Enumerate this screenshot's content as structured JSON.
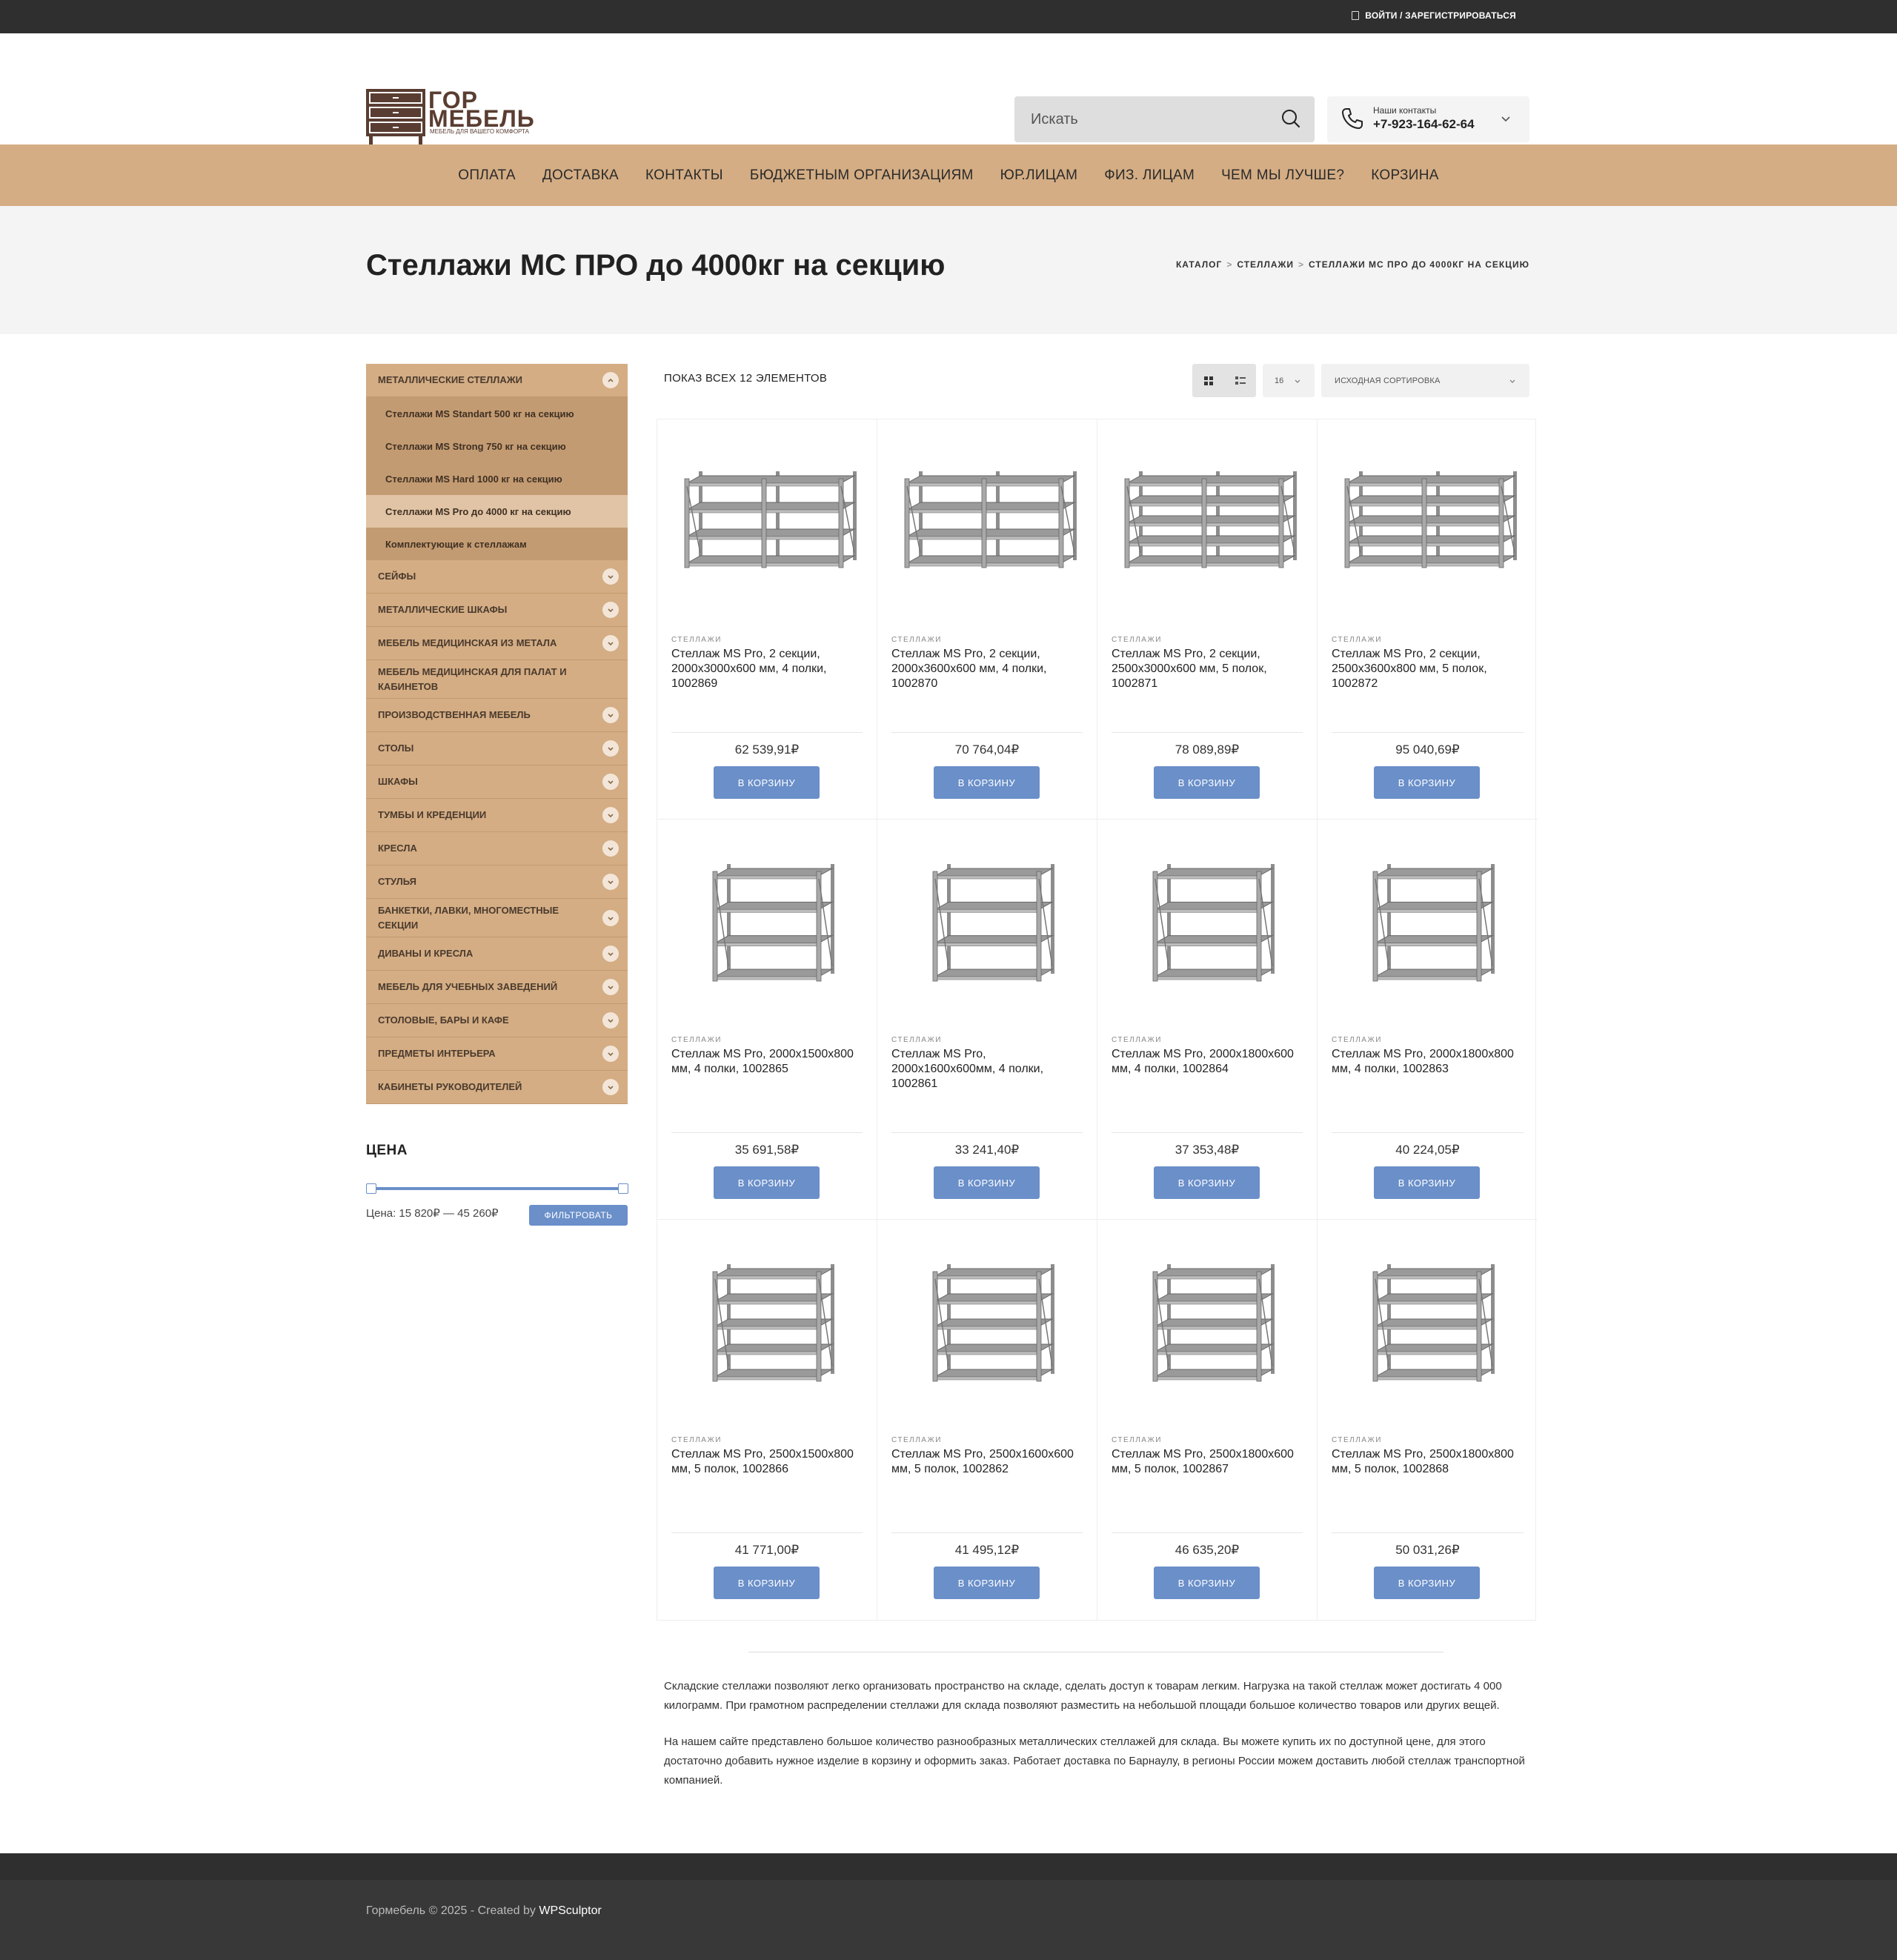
{
  "topbar": {
    "login_label": "ВОЙТИ / ЗАРЕГИСТРИРОВАТЬСЯ"
  },
  "logo": {
    "line1": "ГОР",
    "line2": "МЕБЕЛЬ",
    "tagline": "МЕБЕЛЬ ДЛЯ ВАШЕГО КОМФОРТА"
  },
  "search": {
    "placeholder": "Искать"
  },
  "contacts": {
    "label": "Наши контакты",
    "phone": "+7-923-164-62-64"
  },
  "nav": [
    "ОПЛАТА",
    "ДОСТАВКА",
    "КОНТАКТЫ",
    "БЮДЖЕТНЫМ ОРГАНИЗАЦИЯМ",
    "ЮР.ЛИЦАМ",
    "ФИЗ. ЛИЦАМ",
    "ЧЕМ МЫ ЛУЧШЕ?",
    "КОРЗИНА"
  ],
  "page": {
    "title": "Стеллажи МС ПРО до 4000кг на секцию",
    "breadcrumbs": [
      "КАТАЛОГ",
      "СТЕЛЛАЖИ",
      "СТЕЛЛАЖИ МС ПРО ДО 4000КГ НА СЕКЦИЮ"
    ]
  },
  "sidebar": {
    "open_category": "МЕТАЛЛИЧЕСКИЕ СТЕЛЛАЖИ",
    "subcategories": [
      {
        "label": "Стеллажи MS Standart 500 кг на секцию",
        "active": false
      },
      {
        "label": "Стеллажи MS Strong 750 кг на секцию",
        "active": false
      },
      {
        "label": "Стеллажи MS Hard 1000 кг на секцию",
        "active": false
      },
      {
        "label": "Стеллажи MS Pro до 4000 кг на секцию",
        "active": true
      },
      {
        "label": "Комплектующие к стеллажам",
        "active": false
      }
    ],
    "categories": [
      {
        "label": "СЕЙФЫ",
        "toggle": true
      },
      {
        "label": "МЕТАЛЛИЧЕСКИЕ ШКАФЫ",
        "toggle": true
      },
      {
        "label": "МЕБЕЛЬ МЕДИЦИНСКАЯ ИЗ МЕТАЛА",
        "toggle": true
      },
      {
        "label": "МЕБЕЛЬ МЕДИЦИНСКАЯ ДЛЯ ПАЛАТ И КАБИНЕТОВ",
        "toggle": false
      },
      {
        "label": "ПРОИЗВОДСТВЕННАЯ МЕБЕЛЬ",
        "toggle": true
      },
      {
        "label": "СТОЛЫ",
        "toggle": true
      },
      {
        "label": "ШКАФЫ",
        "toggle": true
      },
      {
        "label": "ТУМБЫ И КРЕДЕНЦИИ",
        "toggle": true
      },
      {
        "label": "КРЕСЛА",
        "toggle": true
      },
      {
        "label": "СТУЛЬЯ",
        "toggle": true
      },
      {
        "label": "БАНКЕТКИ, ЛАВКИ, МНОГОМЕСТНЫЕ СЕКЦИИ",
        "toggle": true
      },
      {
        "label": "ДИВАНЫ И КРЕСЛА",
        "toggle": true
      },
      {
        "label": "МЕБЕЛЬ ДЛЯ УЧЕБНЫХ ЗАВЕДЕНИЙ",
        "toggle": true
      },
      {
        "label": "СТОЛОВЫЕ, БАРЫ И КАФЕ",
        "toggle": true
      },
      {
        "label": "ПРЕДМЕТЫ ИНТЕРЬЕРА",
        "toggle": true
      },
      {
        "label": "КАБИНЕТЫ РУКОВОДИТЕЛЕЙ",
        "toggle": true
      }
    ]
  },
  "price_filter": {
    "title": "ЦЕНА",
    "text": "Цена: 15 820₽ — 45 260₽",
    "button": "ФИЛЬТРОВАТЬ"
  },
  "toolbar": {
    "showing": "ПОКАЗ ВСЕХ 12 ЭЛЕМЕНТОВ",
    "per_page": "16",
    "sorting": "ИСХОДНАЯ СОРТИРОВКА"
  },
  "product_category_label": "СТЕЛЛАЖИ",
  "buy_label": "В КОРЗИНУ",
  "products": [
    {
      "title": "Стеллаж MS Pro, 2 секции, 2000х3000х600 мм, 4 полки, 1002869",
      "price": "62 539,91₽",
      "shelves": 4,
      "sections": 2
    },
    {
      "title": "Стеллаж MS Pro, 2 секции, 2000х3600х600 мм, 4 полки, 1002870",
      "price": "70 764,04₽",
      "shelves": 4,
      "sections": 2
    },
    {
      "title": "Стеллаж MS Pro, 2 секции, 2500х3000х600 мм, 5 полок, 1002871",
      "price": "78 089,89₽",
      "shelves": 5,
      "sections": 2
    },
    {
      "title": "Стеллаж MS Pro, 2 секции, 2500х3600х800 мм, 5 полок, 1002872",
      "price": "95 040,69₽",
      "shelves": 5,
      "sections": 2
    },
    {
      "title": "Стеллаж MS Pro, 2000х1500х800 мм, 4 полки, 1002865",
      "price": "35 691,58₽",
      "shelves": 4,
      "sections": 1
    },
    {
      "title": "Стеллаж MS Pro, 2000х1600х600мм, 4 полки, 1002861",
      "price": "33 241,40₽",
      "shelves": 4,
      "sections": 1
    },
    {
      "title": "Стеллаж MS Pro, 2000х1800х600 мм, 4 полки, 1002864",
      "price": "37 353,48₽",
      "shelves": 4,
      "sections": 1
    },
    {
      "title": "Стеллаж MS Pro, 2000х1800х800 мм, 4 полки, 1002863",
      "price": "40 224,05₽",
      "shelves": 4,
      "sections": 1
    },
    {
      "title": "Стеллаж MS Pro, 2500х1500х800 мм, 5 полок, 1002866",
      "price": "41 771,00₽",
      "shelves": 5,
      "sections": 1
    },
    {
      "title": "Стеллаж MS Pro, 2500х1600х600 мм, 5 полок, 1002862",
      "price": "41 495,12₽",
      "shelves": 5,
      "sections": 1
    },
    {
      "title": "Стеллаж MS Pro, 2500х1800х600 мм, 5 полок, 1002867",
      "price": "46 635,20₽",
      "shelves": 5,
      "sections": 1
    },
    {
      "title": "Стеллаж MS Pro, 2500х1800х800 мм, 5 полок, 1002868",
      "price": "50 031,26₽",
      "shelves": 5,
      "sections": 1
    }
  ],
  "description": [
    "Складские стеллажи позволяют легко организовать пространство на складе, сделать доступ к товарам легким. Нагрузка на такой стеллаж может достигать 4 000 килограмм. При грамотном распределении стеллажи для склада позволяют разместить на небольшой площади большое количество товаров или других вещей.",
    "На нашем сайте представлено большое количество разнообразных металлических стеллажей для склада. Вы можете купить их по доступной цене, для этого достаточно добавить нужное изделие в корзину и оформить заказ. Работает доставка по Барнаулу, в регионы России можем доставить любой стеллаж транспортной компанией."
  ],
  "footer": {
    "copyright": "Гормебель © 2025 - Created by",
    "creator": "WPSculptor"
  },
  "colors": {
    "accent_tan": "#d4ad84",
    "button_blue": "#6a8fc9",
    "dark": "#2f2f2f",
    "brand_brown": "#5a3d32"
  },
  "icons": [
    "login-icon",
    "search-icon",
    "phone-icon",
    "chevron-down-icon",
    "chevron-up-icon",
    "grid-view-icon",
    "list-view-icon"
  ]
}
